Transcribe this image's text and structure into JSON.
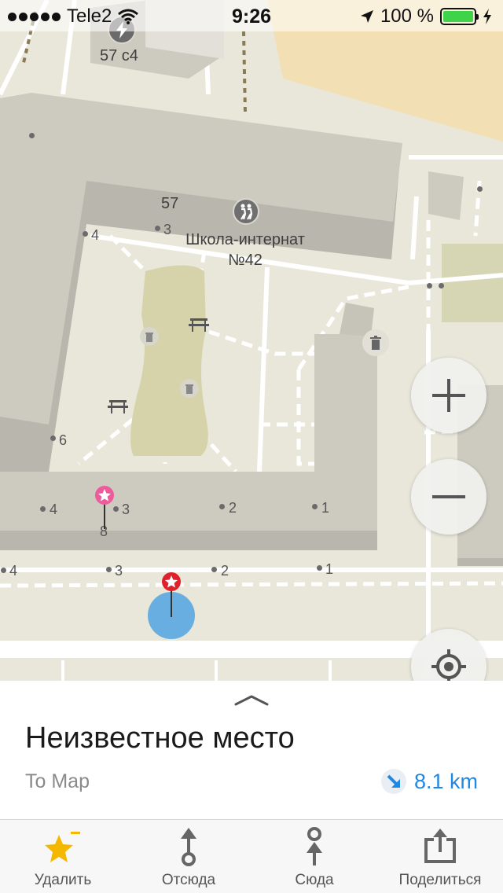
{
  "status_bar": {
    "carrier": "Tele2",
    "time": "9:26",
    "battery_percent": "100 %",
    "battery_level": 1.0
  },
  "map": {
    "labels": {
      "building_57c4": "57 с4",
      "building_57": "57",
      "school_line1": "Школа-интернат",
      "school_line2": "№42",
      "n4a": "4",
      "n3a": "3",
      "n6": "6",
      "n4b": "4",
      "n3b": "3",
      "n8": "8",
      "n2a": "2",
      "n1a": "1",
      "n4c": "4",
      "n3c": "3",
      "n2b": "2",
      "n1b": "1"
    },
    "icons": {
      "charging": "lightning-icon",
      "school": "children-crossing-icon",
      "trash": "trash-icon",
      "bench": "bench-icon",
      "bookmark_pin": "pink-star-pin-icon",
      "selected_pin": "red-star-pin-icon",
      "location": "my-location-icon"
    },
    "controls": {
      "zoom_in": "+",
      "zoom_out": "−"
    }
  },
  "place": {
    "title": "Неизвестное место",
    "subtitle": "To Map",
    "distance": "8.1 km"
  },
  "toolbar": {
    "items": [
      {
        "label": "Удалить",
        "icon": "star-remove-icon"
      },
      {
        "label": "Отсюда",
        "icon": "route-from-icon"
      },
      {
        "label": "Сюда",
        "icon": "route-to-icon"
      },
      {
        "label": "Поделиться",
        "icon": "share-icon"
      }
    ]
  },
  "colors": {
    "accent_blue": "#1e88e5",
    "star_yellow": "#f5b800",
    "pin_red": "#e0202a",
    "pin_pink": "#ee5b9a",
    "location_blue": "#5aa7e0",
    "building_gray": "#cdcbc0",
    "park_green": "#d6d3aa"
  }
}
